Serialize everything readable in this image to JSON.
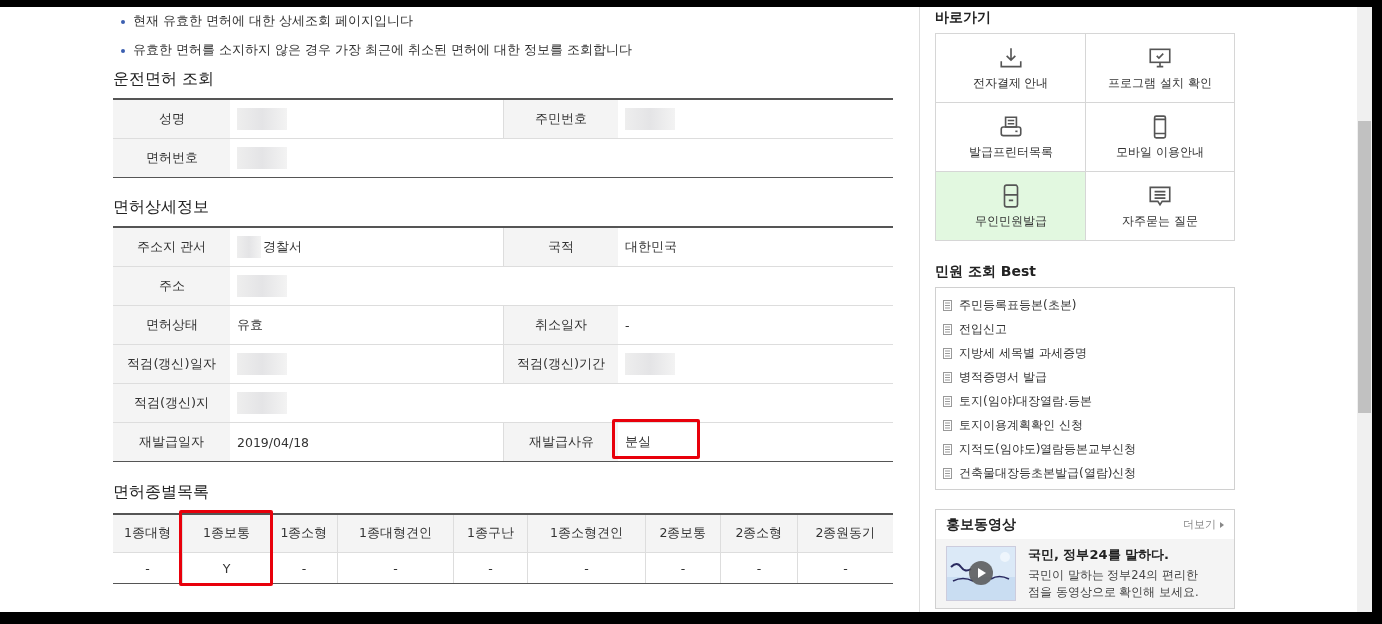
{
  "notices": [
    "현재 유효한 면허에 대한 상세조회 페이지입니다",
    "유효한 면허를 소지하지 않은 경우 가장 최근에 취소된 면허에 대한 정보를 조회합니다"
  ],
  "license_lookup": {
    "title": "운전면허 조회",
    "rows": [
      [
        {
          "label": "성명",
          "redacted": true
        },
        {
          "label": "주민번호",
          "redacted": true
        }
      ],
      [
        {
          "label": "면허번호",
          "redacted": true
        }
      ]
    ]
  },
  "license_detail": {
    "title": "면허상세정보",
    "rows": [
      [
        {
          "label": "주소지 관서",
          "value": "경찰서",
          "redacted": true
        },
        {
          "label": "국적",
          "value": "대한민국"
        }
      ],
      [
        {
          "label": "주소",
          "redacted": true
        }
      ],
      [
        {
          "label": "면허상태",
          "value": "유효"
        },
        {
          "label": "취소일자",
          "value": "-"
        }
      ],
      [
        {
          "label": "적검(갱신)일자",
          "redacted": true
        },
        {
          "label": "적검(갱신)기간",
          "redacted": true
        }
      ],
      [
        {
          "label": "적검(갱신)지",
          "redacted": true
        }
      ],
      [
        {
          "label": "재발급일자",
          "value": "2019/04/18"
        },
        {
          "label": "재발급사유",
          "value": "분실",
          "highlighted": true
        }
      ]
    ]
  },
  "license_types": {
    "title": "면허종별목록",
    "columns": [
      {
        "name": "1종대형",
        "value": "-"
      },
      {
        "name": "1종보통",
        "value": "Y",
        "highlighted": true
      },
      {
        "name": "1종소형",
        "value": "-"
      },
      {
        "name": "1종대형견인",
        "value": "-"
      },
      {
        "name": "1종구난",
        "value": "-"
      },
      {
        "name": "1종소형견인",
        "value": "-"
      },
      {
        "name": "2종보통",
        "value": "-"
      },
      {
        "name": "2종소형",
        "value": "-"
      },
      {
        "name": "2종원동기",
        "value": "-"
      }
    ]
  },
  "shortcuts": {
    "title": "바로가기",
    "items": [
      {
        "kind": "download",
        "label": "전자결제 안내",
        "selected": false
      },
      {
        "kind": "monitor",
        "label": "프로그램 설치 확인",
        "selected": false
      },
      {
        "kind": "printer",
        "label": "발급프린터목록",
        "selected": false
      },
      {
        "kind": "phone",
        "label": "모바일 이용안내",
        "selected": false
      },
      {
        "kind": "kiosk",
        "label": "무인민원발급",
        "selected": true
      },
      {
        "kind": "chat",
        "label": "자주묻는 질문",
        "selected": false
      }
    ]
  },
  "best": {
    "title": "민원 조회 Best",
    "items": [
      "주민등록표등본(초본)",
      "전입신고",
      "지방세 세목별 과세증명",
      "병적증명서 발급",
      "토지(임야)대장열람.등본",
      "토지이용계획확인 신청",
      "지적도(임야도)열람등본교부신청",
      "건축물대장등초본발급(열람)신청"
    ]
  },
  "video": {
    "title": "홍보동영상",
    "more": "더보기",
    "headline": "국민, 정부24를 말하다.",
    "description": "국민이 말하는 정부24의 편리한 점을 동영상으로 확인해 보세요."
  }
}
